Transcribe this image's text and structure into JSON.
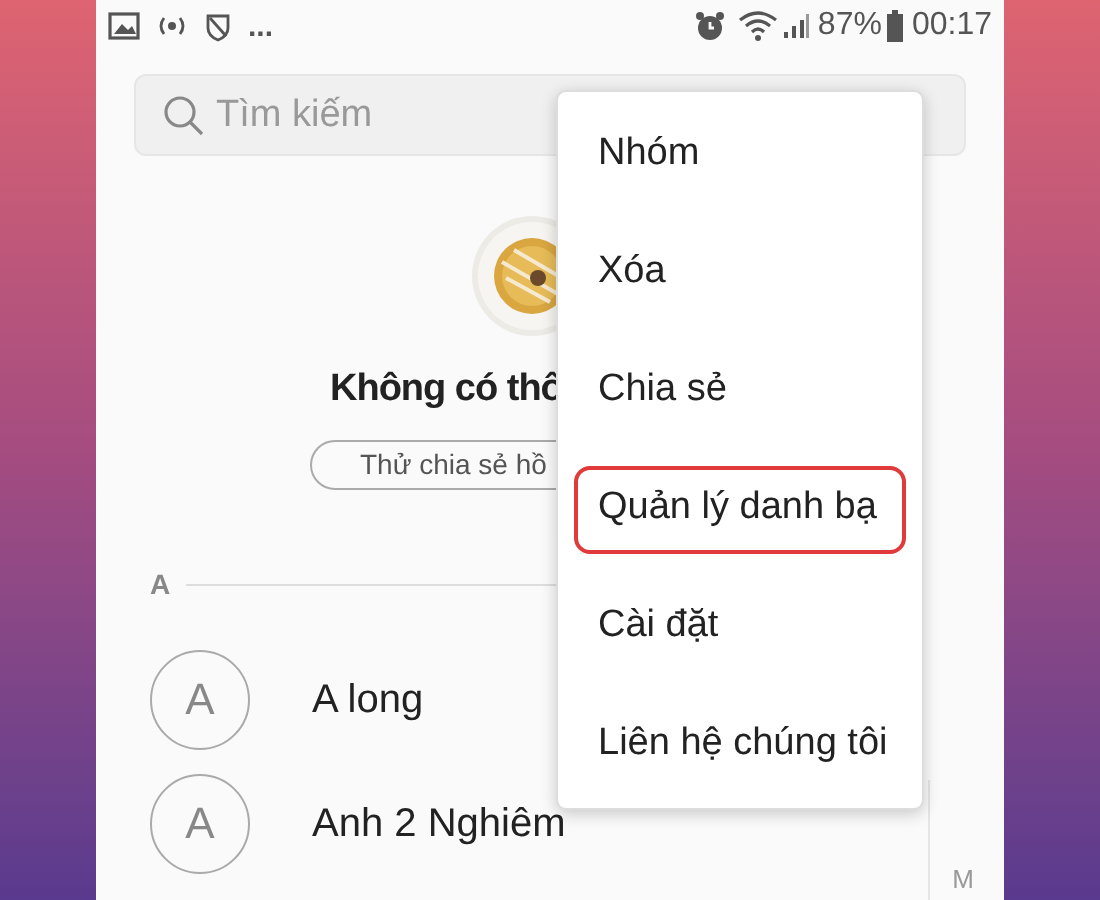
{
  "status_bar": {
    "overflow": "...",
    "battery": "87%",
    "time": "00:17"
  },
  "search": {
    "placeholder": "Tìm kiếm"
  },
  "empty_state": {
    "kind": "picture",
    "title": "Không có thô",
    "button": "Thử chia sẻ hồ"
  },
  "section": {
    "letter": "A"
  },
  "contacts": [
    {
      "initial": "A",
      "name": "A long"
    },
    {
      "initial": "A",
      "name": "Anh 2 Nghiêm"
    }
  ],
  "index_bar": [
    "M"
  ],
  "menu": [
    {
      "label": "Nhóm",
      "highlighted": false
    },
    {
      "label": "Xóa",
      "highlighted": false
    },
    {
      "label": "Chia sẻ",
      "highlighted": false
    },
    {
      "label": "Quản lý danh bạ",
      "highlighted": true
    },
    {
      "label": "Cài đặt",
      "highlighted": false
    },
    {
      "label": "Liên hệ chúng tôi",
      "highlighted": false
    }
  ]
}
